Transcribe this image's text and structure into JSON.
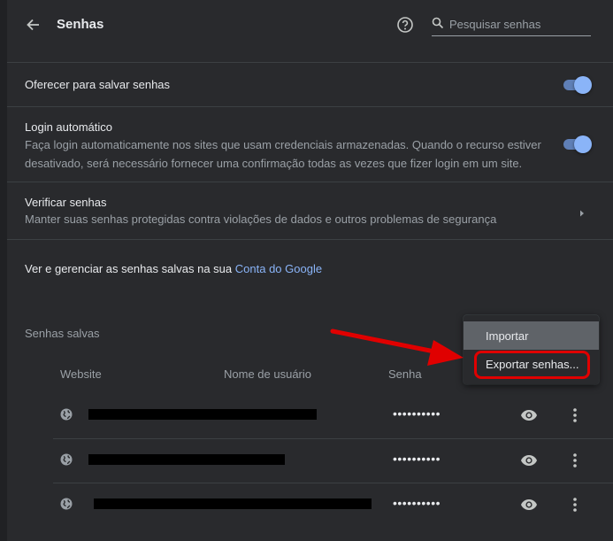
{
  "header": {
    "title": "Senhas",
    "search_placeholder": "Pesquisar senhas"
  },
  "settings": {
    "offer_save": {
      "label": "Oferecer para salvar senhas",
      "enabled": true
    },
    "auto_login": {
      "label": "Login automático",
      "description_line1": "Faça login automaticamente nos sites que usam credenciais armazenadas. Quando o recurso estiver",
      "description_line2": "desativado, será necessário fornecer uma confirmação todas as vezes que fizer login em um site.",
      "enabled": true
    },
    "check_passwords": {
      "label": "Verificar senhas",
      "description": "Manter suas senhas protegidas contra violações de dados e outros problemas de segurança"
    },
    "google_account": {
      "text": "Ver e gerenciar as senhas salvas na sua ",
      "link": "Conta do Google"
    }
  },
  "saved": {
    "title": "Senhas salvas",
    "columns": [
      "Website",
      "Nome de usuário",
      "Senha"
    ],
    "rows": [
      {
        "password_mask": "••••••••••"
      },
      {
        "password_mask": "••••••••••"
      },
      {
        "password_mask": "••••••••••"
      }
    ]
  },
  "menu": {
    "items": [
      "Importar",
      "Exportar senhas..."
    ]
  },
  "colors": {
    "accent": "#8ab4f8",
    "background": "#292a2d",
    "annotation": "#e00000"
  }
}
